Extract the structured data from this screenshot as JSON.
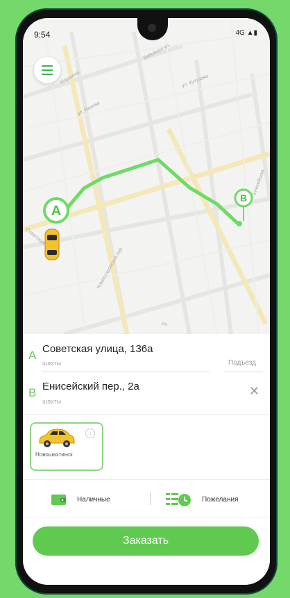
{
  "status_bar": {
    "time": "9:54",
    "signal": "4G"
  },
  "map": {
    "marker_a": "A",
    "marker_b": "B",
    "streets": [
      "Забойная ул.",
      "Маршала",
      "ул. Кутузова",
      "ул. Нахова",
      "Комиссаровский пер.",
      "Енисейская",
      "Советская",
      "ул."
    ]
  },
  "route": {
    "from": {
      "letter": "A",
      "address": "Советская улица, 136а",
      "sub": "шахты",
      "entrance_placeholder": "Подъезд"
    },
    "to": {
      "letter": "B",
      "address": "Енисейский пер., 2а",
      "sub": "шахты"
    }
  },
  "tariff": {
    "name": "Новошахтинск",
    "info_symbol": "i"
  },
  "payment": {
    "method": "Наличные",
    "wishes": "Пожелания"
  },
  "order_button": "Заказать",
  "colors": {
    "accent": "#5fca4f",
    "route": "#6ddb65",
    "background": "#74d96a"
  }
}
